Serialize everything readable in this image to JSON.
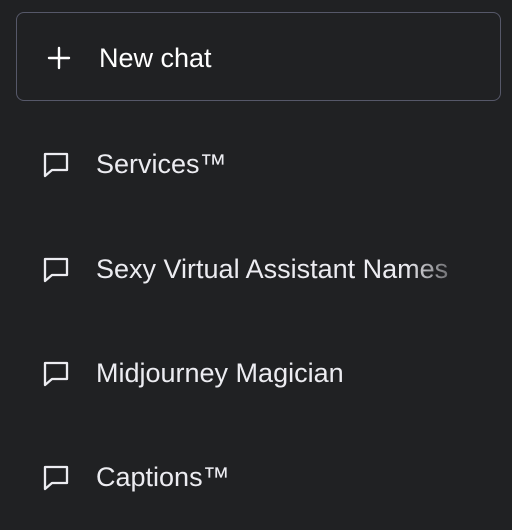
{
  "sidebar": {
    "new_chat": {
      "label": "New chat",
      "icon": "plus-icon"
    },
    "conversations": [
      {
        "title": "Services™",
        "icon": "chat-bubble-icon"
      },
      {
        "title": "Sexy Virtual Assistant Names",
        "icon": "chat-bubble-icon"
      },
      {
        "title": "Midjourney Magician",
        "icon": "chat-bubble-icon"
      },
      {
        "title": "Captions™",
        "icon": "chat-bubble-icon"
      }
    ]
  },
  "colors": {
    "background": "#202123",
    "border": "#565869",
    "text": "#ececf1"
  }
}
